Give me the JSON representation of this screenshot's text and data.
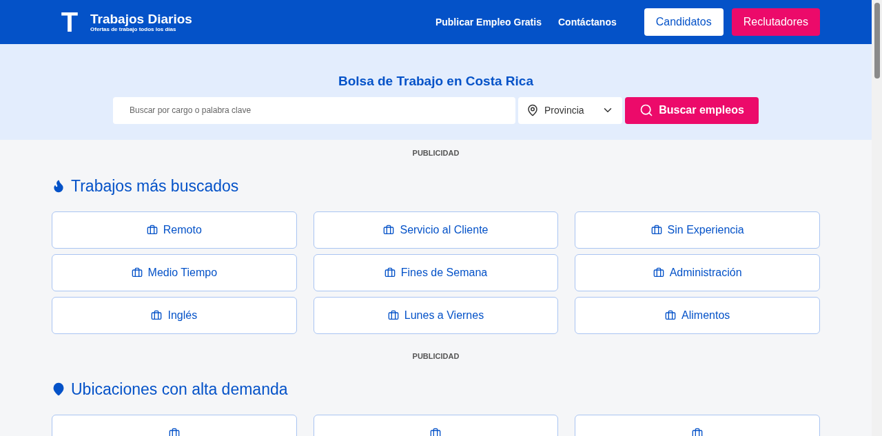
{
  "header": {
    "logo": {
      "mark": "T",
      "title": "Trabajos Diarios",
      "tagline": "Ofertas de trabajo todos los días"
    },
    "nav": [
      "Publicar Empleo Gratis",
      "Contáctanos"
    ],
    "buttons": [
      {
        "label": "Candidatos",
        "kind": "outline"
      },
      {
        "label": "Reclutadores",
        "kind": "primary"
      }
    ]
  },
  "hero": {
    "title": "Bolsa de Trabajo en Costa Rica",
    "search": {
      "placeholder": "Buscar por cargo o palabra clave"
    },
    "province": {
      "value": "Provincia"
    },
    "button": "Buscar empleos"
  },
  "sections": [
    {
      "ad": "PUBLICIDAD",
      "title": "Trabajos más buscados",
      "kind": "popular",
      "items": [
        "Remoto",
        "Servicio al Cliente",
        "Sin Experiencia",
        "Medio Tiempo",
        "Fines de Semana",
        "Administración",
        "Inglés",
        "Lunes a Viernes",
        "Alimentos"
      ]
    },
    {
      "ad": "PUBLICIDAD",
      "title": "Ubicaciones con alta demanda",
      "kind": "locations"
    }
  ]
}
